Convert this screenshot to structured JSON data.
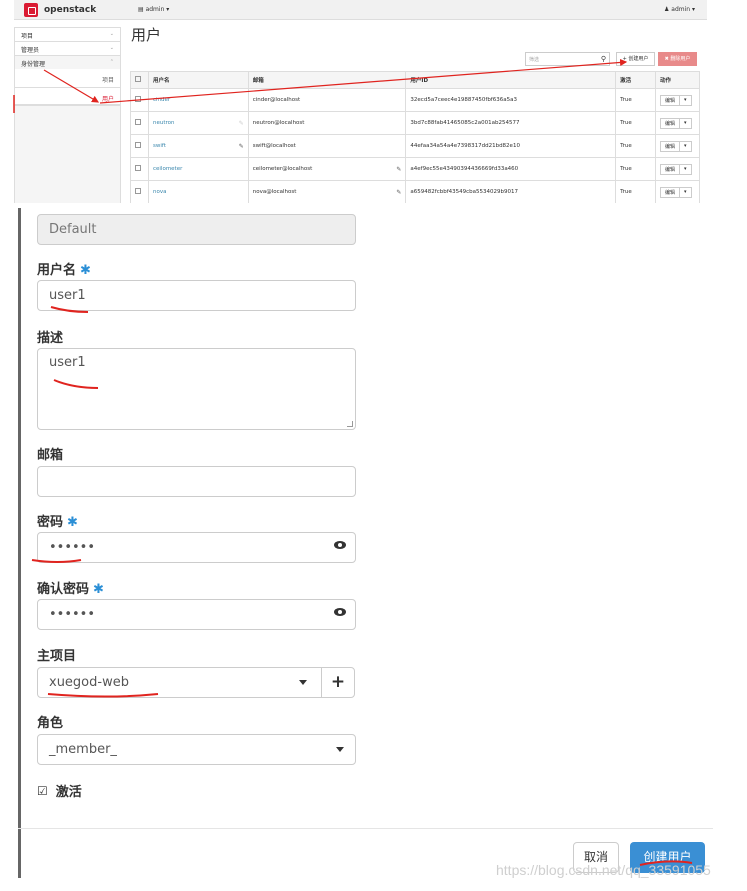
{
  "top": {
    "logo_text": "openstack",
    "project_menu": "▤ admin ▾",
    "user_menu": "♟ admin ▾",
    "sidebar": {
      "items": [
        {
          "label": "项目",
          "chevron": "⌄"
        },
        {
          "label": "管理员",
          "chevron": "⌄"
        },
        {
          "label": "身份管理",
          "chevron": "⌃"
        }
      ],
      "sub_items": [
        "项目",
        "用户"
      ]
    },
    "page_title": "用户",
    "filter_placeholder": "筛选",
    "create_button": "+ 创建用户",
    "delete_button": "✖ 删除用户",
    "table": {
      "headers": [
        "用户名",
        "邮箱",
        "用户ID",
        "激活",
        "动作"
      ],
      "rows": [
        {
          "name": "cinder",
          "email": "cinder@localhost",
          "id": "32ecd5a7ceec4e19887450fbf636a5a3",
          "active": "True",
          "action": "编辑"
        },
        {
          "name": "neutron",
          "email": "neutron@localhost",
          "id": "3bd7c88fab41465085c2a001ab254577",
          "active": "True",
          "action": "编辑"
        },
        {
          "name": "swift",
          "email": "swift@localhost",
          "id": "44efaa34a54a4e7398317dd21bd82e10",
          "active": "True",
          "action": "编辑"
        },
        {
          "name": "ceilometer",
          "email": "ceilometer@localhost",
          "id": "a4ef9ec55e43490394436669fd33a460",
          "active": "True",
          "action": "编辑"
        },
        {
          "name": "nova",
          "email": "nova@localhost",
          "id": "a659482fcbbf43549cba5534029b9017",
          "active": "True",
          "action": "编辑"
        }
      ]
    }
  },
  "form": {
    "domain_value": "Default",
    "username_label": "用户名",
    "username_value": "user1",
    "description_label": "描述",
    "description_value": "user1",
    "email_label": "邮箱",
    "email_value": "",
    "password_label": "密码",
    "password_value": "••••••",
    "confirm_label": "确认密码",
    "confirm_value": "••••••",
    "project_label": "主项目",
    "project_value": "xuegod-web",
    "role_label": "角色",
    "role_value": "_member_",
    "active_label": "激活",
    "required_mark": "✱",
    "cancel_button": "取消",
    "submit_button": "创建用户"
  },
  "watermark": "https://blog.csdn.net/qq_33591055",
  "colors": {
    "accent_red": "#da1a32",
    "primary_blue": "#3a8fd4",
    "link_blue": "#3a87ad",
    "annotation_red": "#e0241f"
  }
}
